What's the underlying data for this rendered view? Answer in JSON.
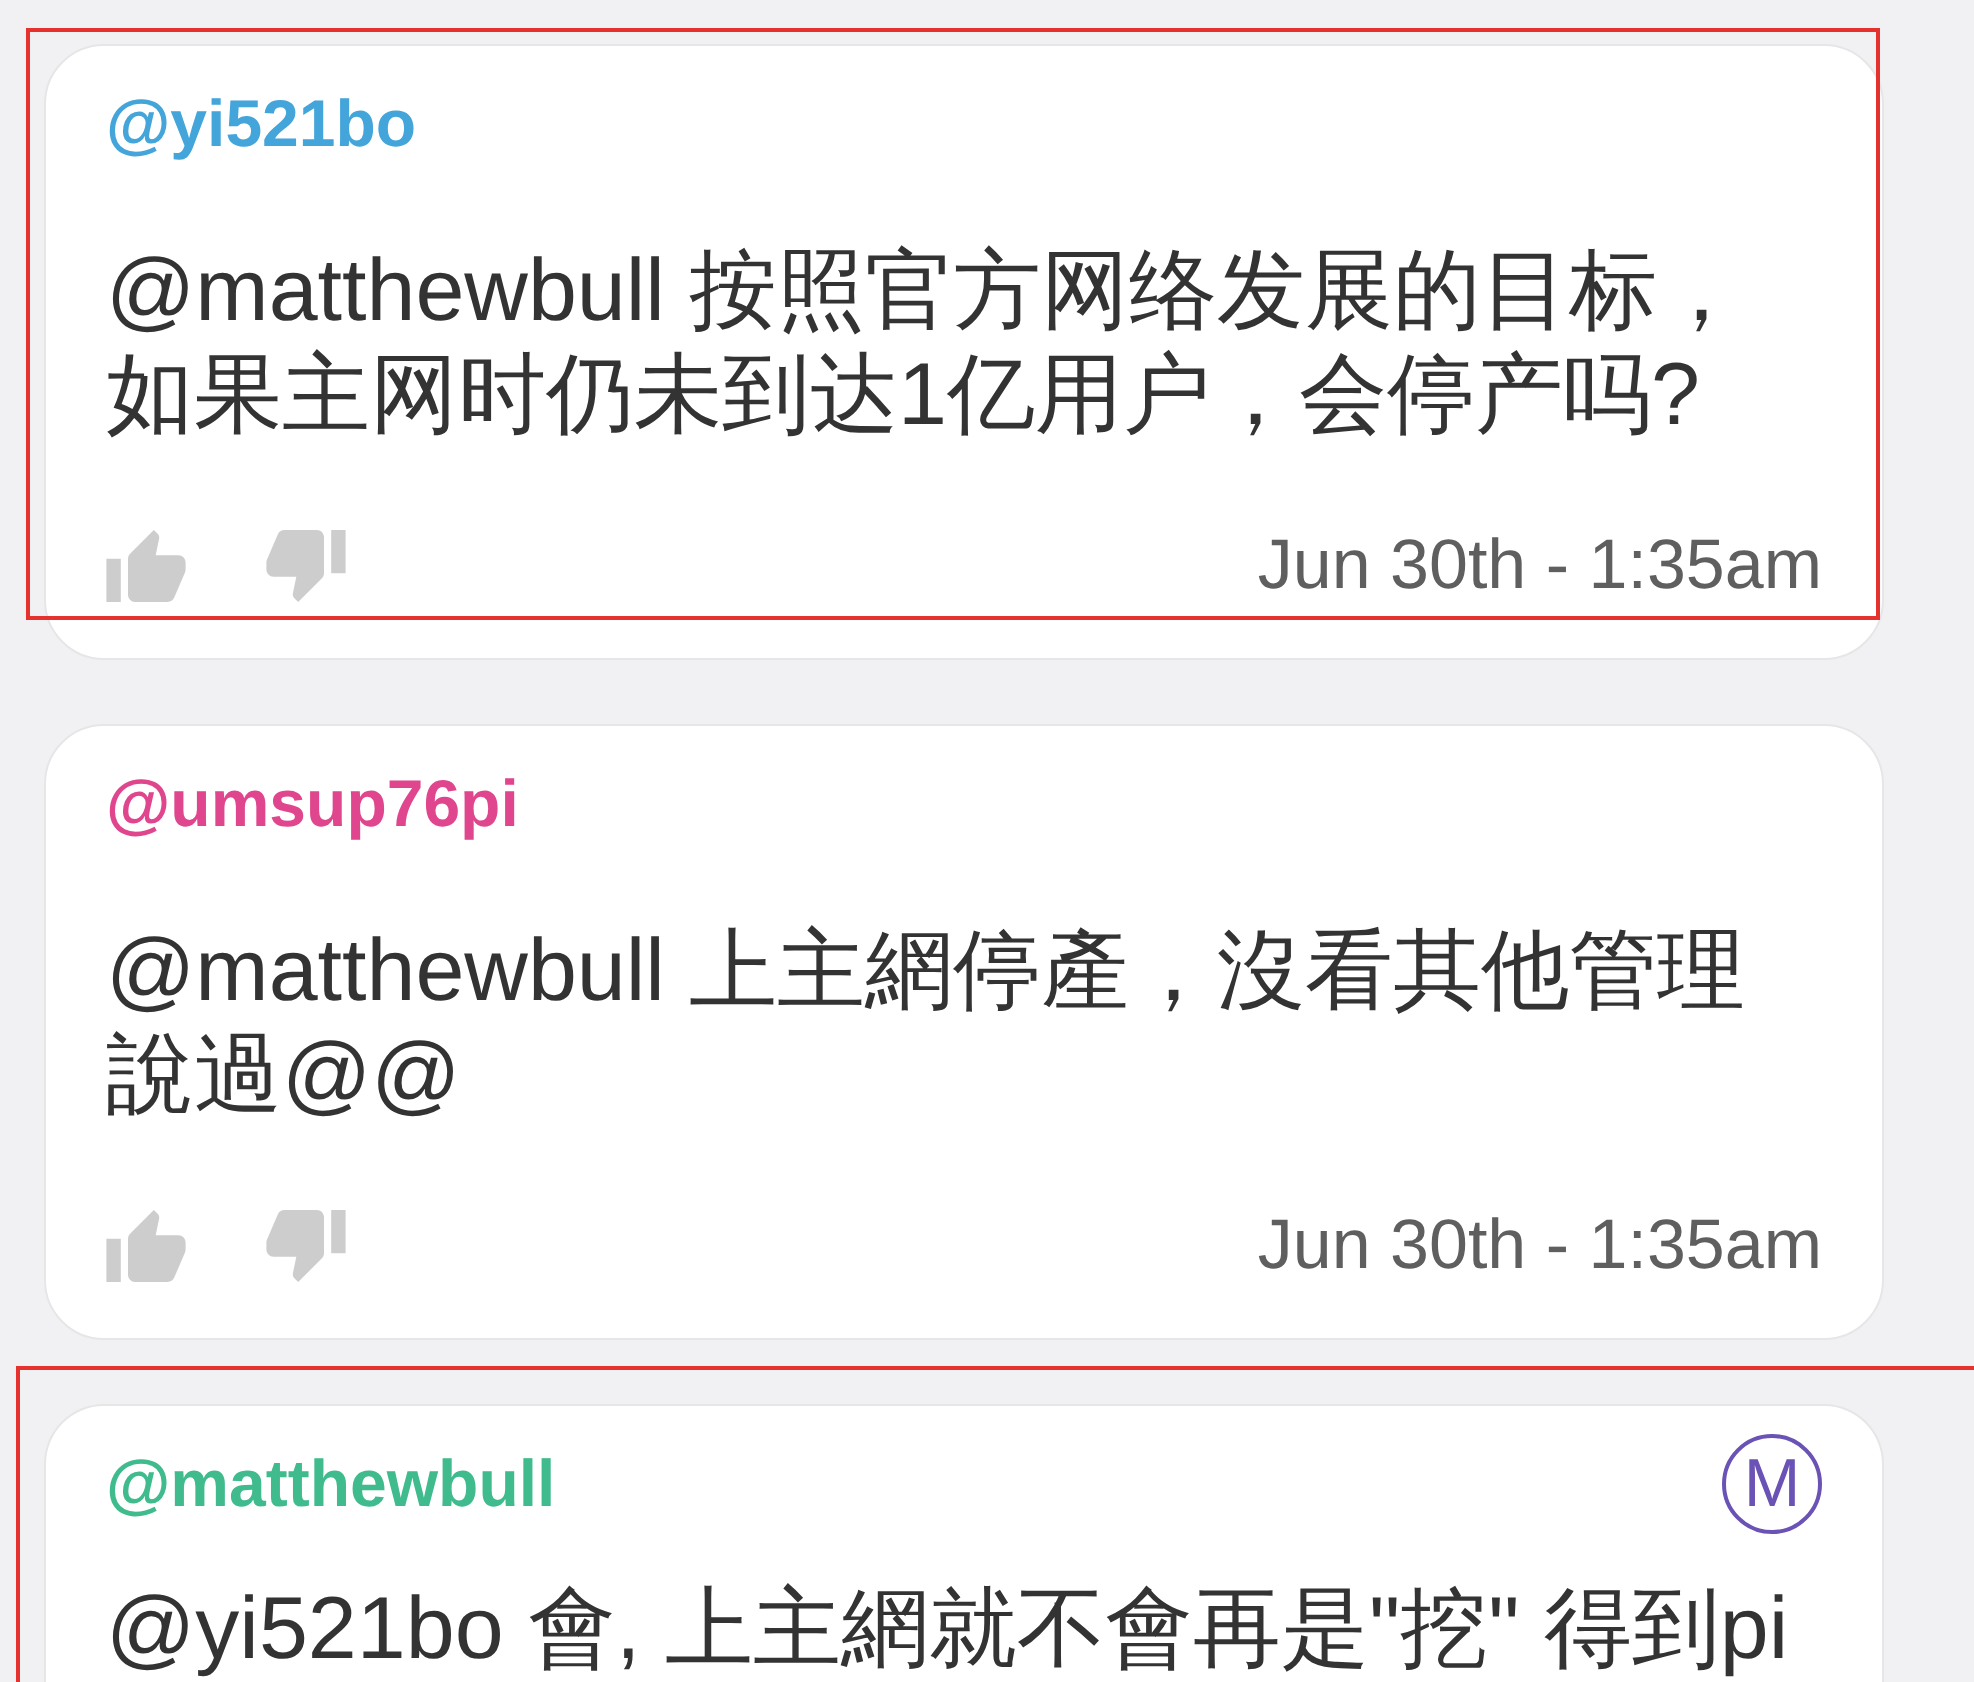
{
  "comments": [
    {
      "username": "@yi521bo",
      "color": "#44a5da",
      "highlighted": true,
      "text": "@matthewbull 按照官方网络发展的目标，如果主网时仍未到达1亿用户，会停产吗?",
      "liked": false,
      "disliked": false,
      "timestamp": "Jun 30th - 1:35am"
    },
    {
      "username": "@umsup76pi",
      "color": "#e0468e",
      "highlighted": false,
      "text": "@matthewbull 上主網停產，沒看其他管理說過@@",
      "liked": false,
      "disliked": false,
      "timestamp": "Jun 30th - 1:35am"
    },
    {
      "username": "@matthewbull",
      "color": "#40bb8e",
      "badge": "M",
      "highlighted": true,
      "text": "@yi521bo 會, 上主網就不會再是\"挖\" 得到pi"
    }
  ]
}
